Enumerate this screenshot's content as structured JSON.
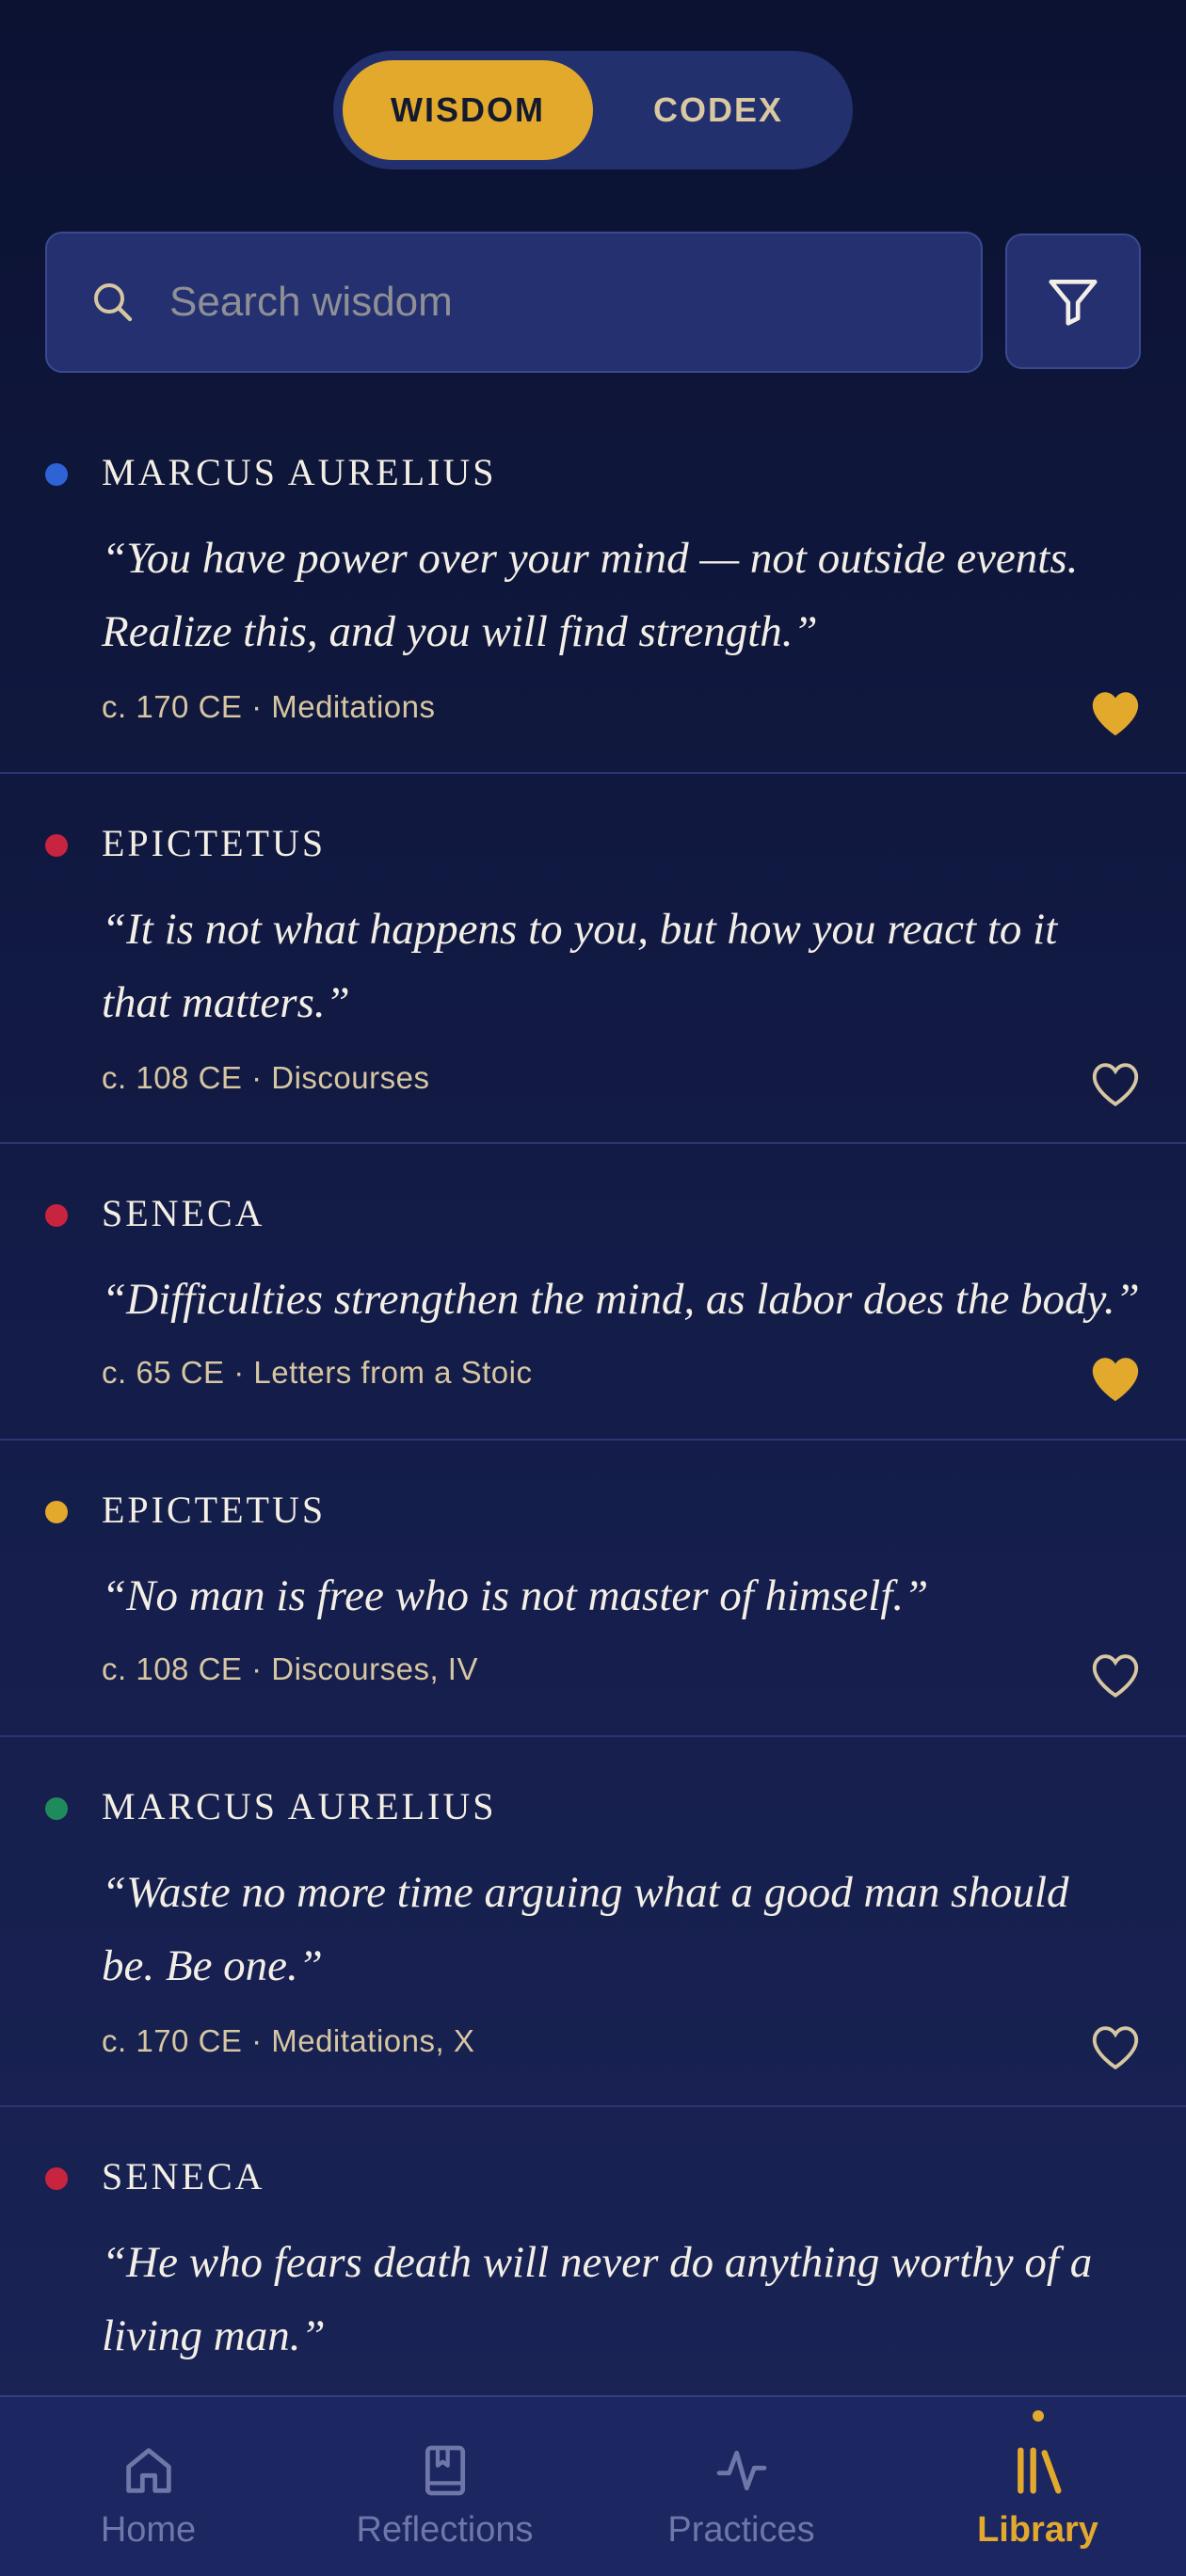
{
  "segmented": {
    "wisdom": "WISDOM",
    "codex": "CODEX",
    "active": "wisdom"
  },
  "search": {
    "placeholder": "Search wisdom"
  },
  "quotes": [
    {
      "author": "MARCUS AURELIUS",
      "dot_color": "#2e63d6",
      "line1": "“You have power over your mind — not outside events.",
      "line2": "Realize this, and you will find strength.”",
      "meta": "c. 170 CE · Meditations",
      "favorite": true
    },
    {
      "author": "EPICTETUS",
      "dot_color": "#c8233f",
      "line1": "“It is not what happens to you, but how you react to it",
      "line2": "that matters.”",
      "meta": "c. 108 CE · Discourses",
      "favorite": false
    },
    {
      "author": "SENECA",
      "dot_color": "#c8233f",
      "line1": "“Difficulties strengthen the mind, as labor does the body.”",
      "line2": "",
      "meta": "c. 65 CE · Letters from a Stoic",
      "favorite": true
    },
    {
      "author": "EPICTETUS",
      "dot_color": "#e3a92d",
      "line1": "“No man is free who is not master of himself.”",
      "line2": "",
      "meta": "c. 108 CE · Discourses, IV",
      "favorite": false
    },
    {
      "author": "MARCUS AURELIUS",
      "dot_color": "#1f8a5b",
      "line1": "“Waste no more time arguing what a good man should",
      "line2": "be. Be one.”",
      "meta": "c. 170 CE · Meditations, X",
      "favorite": false
    },
    {
      "author": "SENECA",
      "dot_color": "#c8233f",
      "line1": "“He who fears death will never do anything worthy of a",
      "line2": "living man.”",
      "meta": "",
      "favorite": false
    }
  ],
  "nav": {
    "home": "Home",
    "reflections": "Reflections",
    "practices": "Practices",
    "library": "Library",
    "active": "library"
  },
  "colors": {
    "accent": "#e3a92d",
    "background": "#0f1740",
    "card_divider": "#2a3672"
  }
}
